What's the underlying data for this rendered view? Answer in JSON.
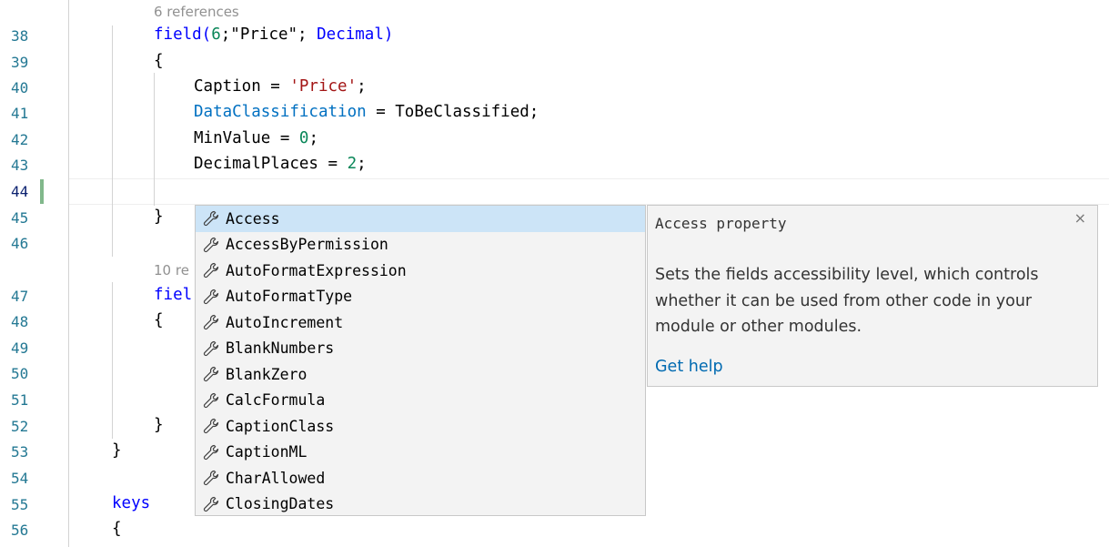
{
  "editor": {
    "colors": {
      "line_number": "#237893",
      "keyword": "#0000ff",
      "number": "#098658",
      "string": "#a31515",
      "property": "#0070c1",
      "codelens": "#919191",
      "selection": "#cce4f7",
      "git_added": "#81b88b"
    },
    "codelens_1": "6 references",
    "codelens_2": "10 re",
    "lines": [
      {
        "n": "38"
      },
      {
        "n": "39"
      },
      {
        "n": "40"
      },
      {
        "n": "41"
      },
      {
        "n": "42"
      },
      {
        "n": "43"
      },
      {
        "n": "44"
      },
      {
        "n": "45"
      },
      {
        "n": "46"
      },
      {
        "n": "47"
      },
      {
        "n": "48"
      },
      {
        "n": "49"
      },
      {
        "n": "50"
      },
      {
        "n": "51"
      },
      {
        "n": "52"
      },
      {
        "n": "53"
      },
      {
        "n": "54"
      },
      {
        "n": "55"
      },
      {
        "n": "56"
      }
    ],
    "code": {
      "l38_fn": "field(",
      "l38_num": "6",
      "l38_rest": ";\"Price\"; ",
      "l38_type": "Decimal",
      "l38_close": ")",
      "l39": "{",
      "l40_key": "Caption = ",
      "l40_val": "'Price'",
      "l40_end": ";",
      "l41_key": "DataClassification",
      "l41_rest": " = ToBeClassified;",
      "l42_key": "MinValue = ",
      "l42_val": "0",
      "l42_end": ";",
      "l43_key": "DecimalPlaces = ",
      "l43_val": "2",
      "l43_end": ";",
      "l45": "}",
      "l47": "fiel",
      "l48": "{",
      "l52": "}",
      "l53": "}",
      "l55": "keys",
      "l56": "{"
    }
  },
  "suggest": {
    "selected_index": 0,
    "items": [
      {
        "label": "Access",
        "icon": "wrench-icon"
      },
      {
        "label": "AccessByPermission",
        "icon": "wrench-icon"
      },
      {
        "label": "AutoFormatExpression",
        "icon": "wrench-icon"
      },
      {
        "label": "AutoFormatType",
        "icon": "wrench-icon"
      },
      {
        "label": "AutoIncrement",
        "icon": "wrench-icon"
      },
      {
        "label": "BlankNumbers",
        "icon": "wrench-icon"
      },
      {
        "label": "BlankZero",
        "icon": "wrench-icon"
      },
      {
        "label": "CalcFormula",
        "icon": "wrench-icon"
      },
      {
        "label": "CaptionClass",
        "icon": "wrench-icon"
      },
      {
        "label": "CaptionML",
        "icon": "wrench-icon"
      },
      {
        "label": "CharAllowed",
        "icon": "wrench-icon"
      },
      {
        "label": "ClosingDates",
        "icon": "wrench-icon"
      }
    ]
  },
  "details": {
    "title": "Access property",
    "description": "Sets the fields accessibility level, which controls whether it can be used from other code in your module or other modules.",
    "link": "Get help",
    "close_glyph": "×"
  }
}
